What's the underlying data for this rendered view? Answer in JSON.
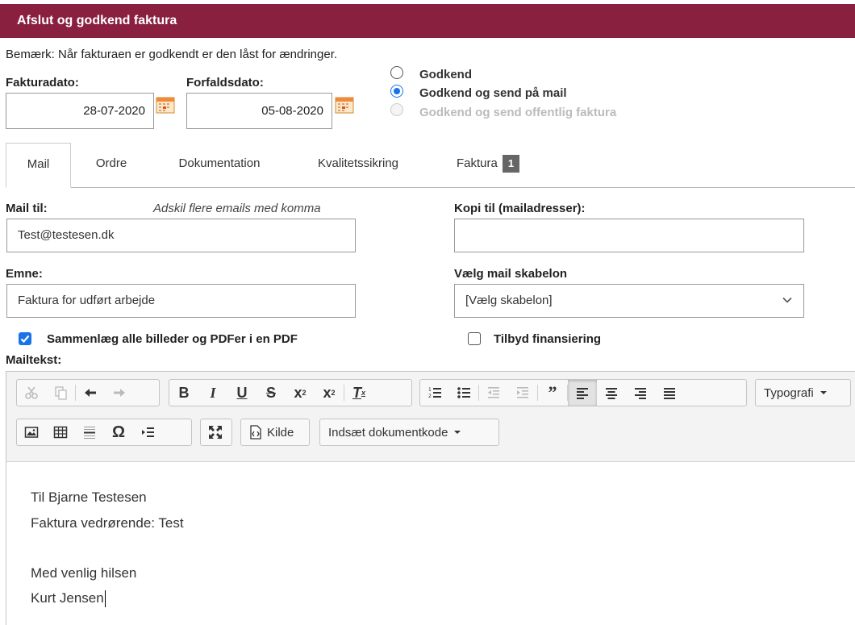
{
  "header": {
    "title": "Afslut og godkend faktura"
  },
  "note": "Bemærk: Når fakturaen er godkendt er den låst for ændringer.",
  "invoice_date": {
    "label": "Fakturadato:",
    "value": "28-07-2020"
  },
  "due_date": {
    "label": "Forfaldsdato:",
    "value": "05-08-2020"
  },
  "approve_options": [
    {
      "label": "Godkend",
      "selected": false,
      "disabled": false
    },
    {
      "label": "Godkend og send på mail",
      "selected": true,
      "disabled": false
    },
    {
      "label": "Godkend og send offentlig faktura",
      "selected": false,
      "disabled": true
    }
  ],
  "tabs": [
    {
      "label": "Mail",
      "active": true
    },
    {
      "label": "Ordre",
      "active": false
    },
    {
      "label": "Dokumentation",
      "active": false
    },
    {
      "label": "Kvalitetssikring",
      "active": false
    },
    {
      "label": "Faktura",
      "active": false,
      "badge": "1"
    }
  ],
  "mail_to": {
    "label": "Mail til:",
    "hint": "Adskil flere emails med komma",
    "value": "Test@testesen.dk"
  },
  "cc": {
    "label": "Kopi til (mailadresser):",
    "value": ""
  },
  "subject": {
    "label": "Emne:",
    "value": "Faktura for udført arbejde"
  },
  "template": {
    "label": "Vælg mail skabelon",
    "selected": "[Vælg skabelon]"
  },
  "merge_checkbox": {
    "label": "Sammenlæg alle billeder og PDFer i en PDF",
    "checked": true
  },
  "finance_checkbox": {
    "label": "Tilbyd finansiering",
    "checked": false
  },
  "mailtext": {
    "label": "Mailtekst:"
  },
  "toolbar": {
    "typography_label": "Typografi",
    "source_label": "Kilde",
    "doc_code_label": "Indsæt dokumentkode",
    "accent_color": "#1a73e8",
    "header_color": "#8a2040"
  },
  "editor_body": {
    "line1": "Til Bjarne Testesen",
    "line2": "Faktura vedrørende: Test",
    "line3": "Med venlig hilsen",
    "line4": "Kurt Jensen"
  }
}
